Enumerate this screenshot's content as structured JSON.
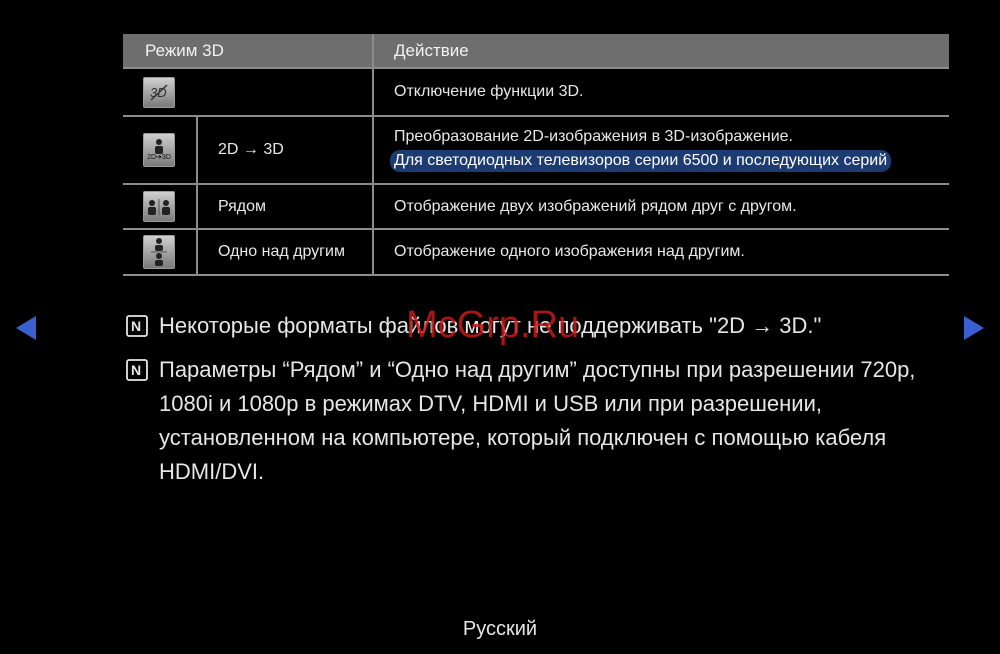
{
  "table": {
    "headers": {
      "mode": "Режим 3D",
      "action": "Действие"
    },
    "rows": [
      {
        "icon": "3d-off-icon",
        "mode": "",
        "action": "Отключение функции 3D."
      },
      {
        "icon": "2d-to-3d-icon",
        "icon_label": "2D➔3D",
        "mode": "2D → 3D",
        "action": "Преобразование 2D-изображения в 3D-изображение.",
        "action_note": "Для светодиодных телевизоров серии 6500 и последующих серий"
      },
      {
        "icon": "side-by-side-icon",
        "mode": "Рядом",
        "action": "Отображение двух изображений рядом друг с другом."
      },
      {
        "icon": "top-bottom-icon",
        "mode": "Одно над другим",
        "action": "Отображение одного изображения над другим."
      }
    ]
  },
  "notes": [
    "Некоторые форматы файлов могут не поддерживать \"2D → 3D.\"",
    "Параметры “Рядом” и “Одно над другим” доступны при разрешении 720p, 1080i и 1080p в режимах DTV, HDMI и USB или при разрешении, установленном на компьютере, который подключен с помощью кабеля HDMI/DVI."
  ],
  "watermark": "McGrp.Ru",
  "footer": {
    "language": "Русский"
  },
  "colors": {
    "header_bg": "#6e6e6e",
    "highlight_bg": "#1d3b73",
    "arrow": "#3a5fd0",
    "watermark": "#c81818"
  }
}
